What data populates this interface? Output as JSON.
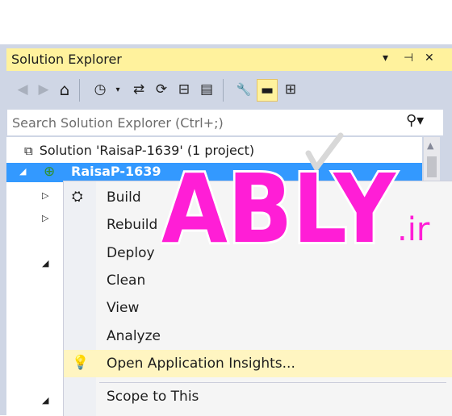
{
  "window": {
    "title": "Solution Explorer",
    "controls": {
      "dropdown": "▾",
      "pin": "⊣",
      "close": "✕"
    }
  },
  "toolbar": {
    "buttons": [
      {
        "name": "back",
        "glyph": "◀"
      },
      {
        "name": "forward",
        "glyph": "▶"
      },
      {
        "name": "home",
        "glyph": "⌂"
      },
      {
        "name": "pending-changes",
        "glyph": "◷"
      },
      {
        "name": "sync",
        "glyph": "⇄"
      },
      {
        "name": "refresh",
        "glyph": "⟳"
      },
      {
        "name": "collapse-all",
        "glyph": "⊟"
      },
      {
        "name": "show-all-files",
        "glyph": "▤"
      },
      {
        "name": "properties",
        "glyph": "🔧"
      },
      {
        "name": "preview",
        "glyph": "▬"
      },
      {
        "name": "class-diagram",
        "glyph": "⊞"
      }
    ]
  },
  "search": {
    "placeholder": "Search Solution Explorer (Ctrl+;)"
  },
  "tree": {
    "solution_label": "Solution 'RaisaP-1639' (1 project)",
    "project_label": "RaisaP-1639"
  },
  "context_menu": {
    "items": [
      {
        "label": "Build"
      },
      {
        "label": "Rebuild"
      },
      {
        "label": "Deploy"
      },
      {
        "label": "Clean"
      },
      {
        "label": "View"
      },
      {
        "label": "Analyze"
      },
      {
        "label": "Open Application Insights..."
      },
      {
        "label": "Scope to This"
      }
    ]
  },
  "watermark": {
    "brand": "ABLY",
    "tld": ".ir"
  },
  "colors": {
    "title_bar": "#fff29d",
    "selection": "#3399ff",
    "menu_highlight": "#fff5c1",
    "watermark": "#ff1ed6"
  }
}
